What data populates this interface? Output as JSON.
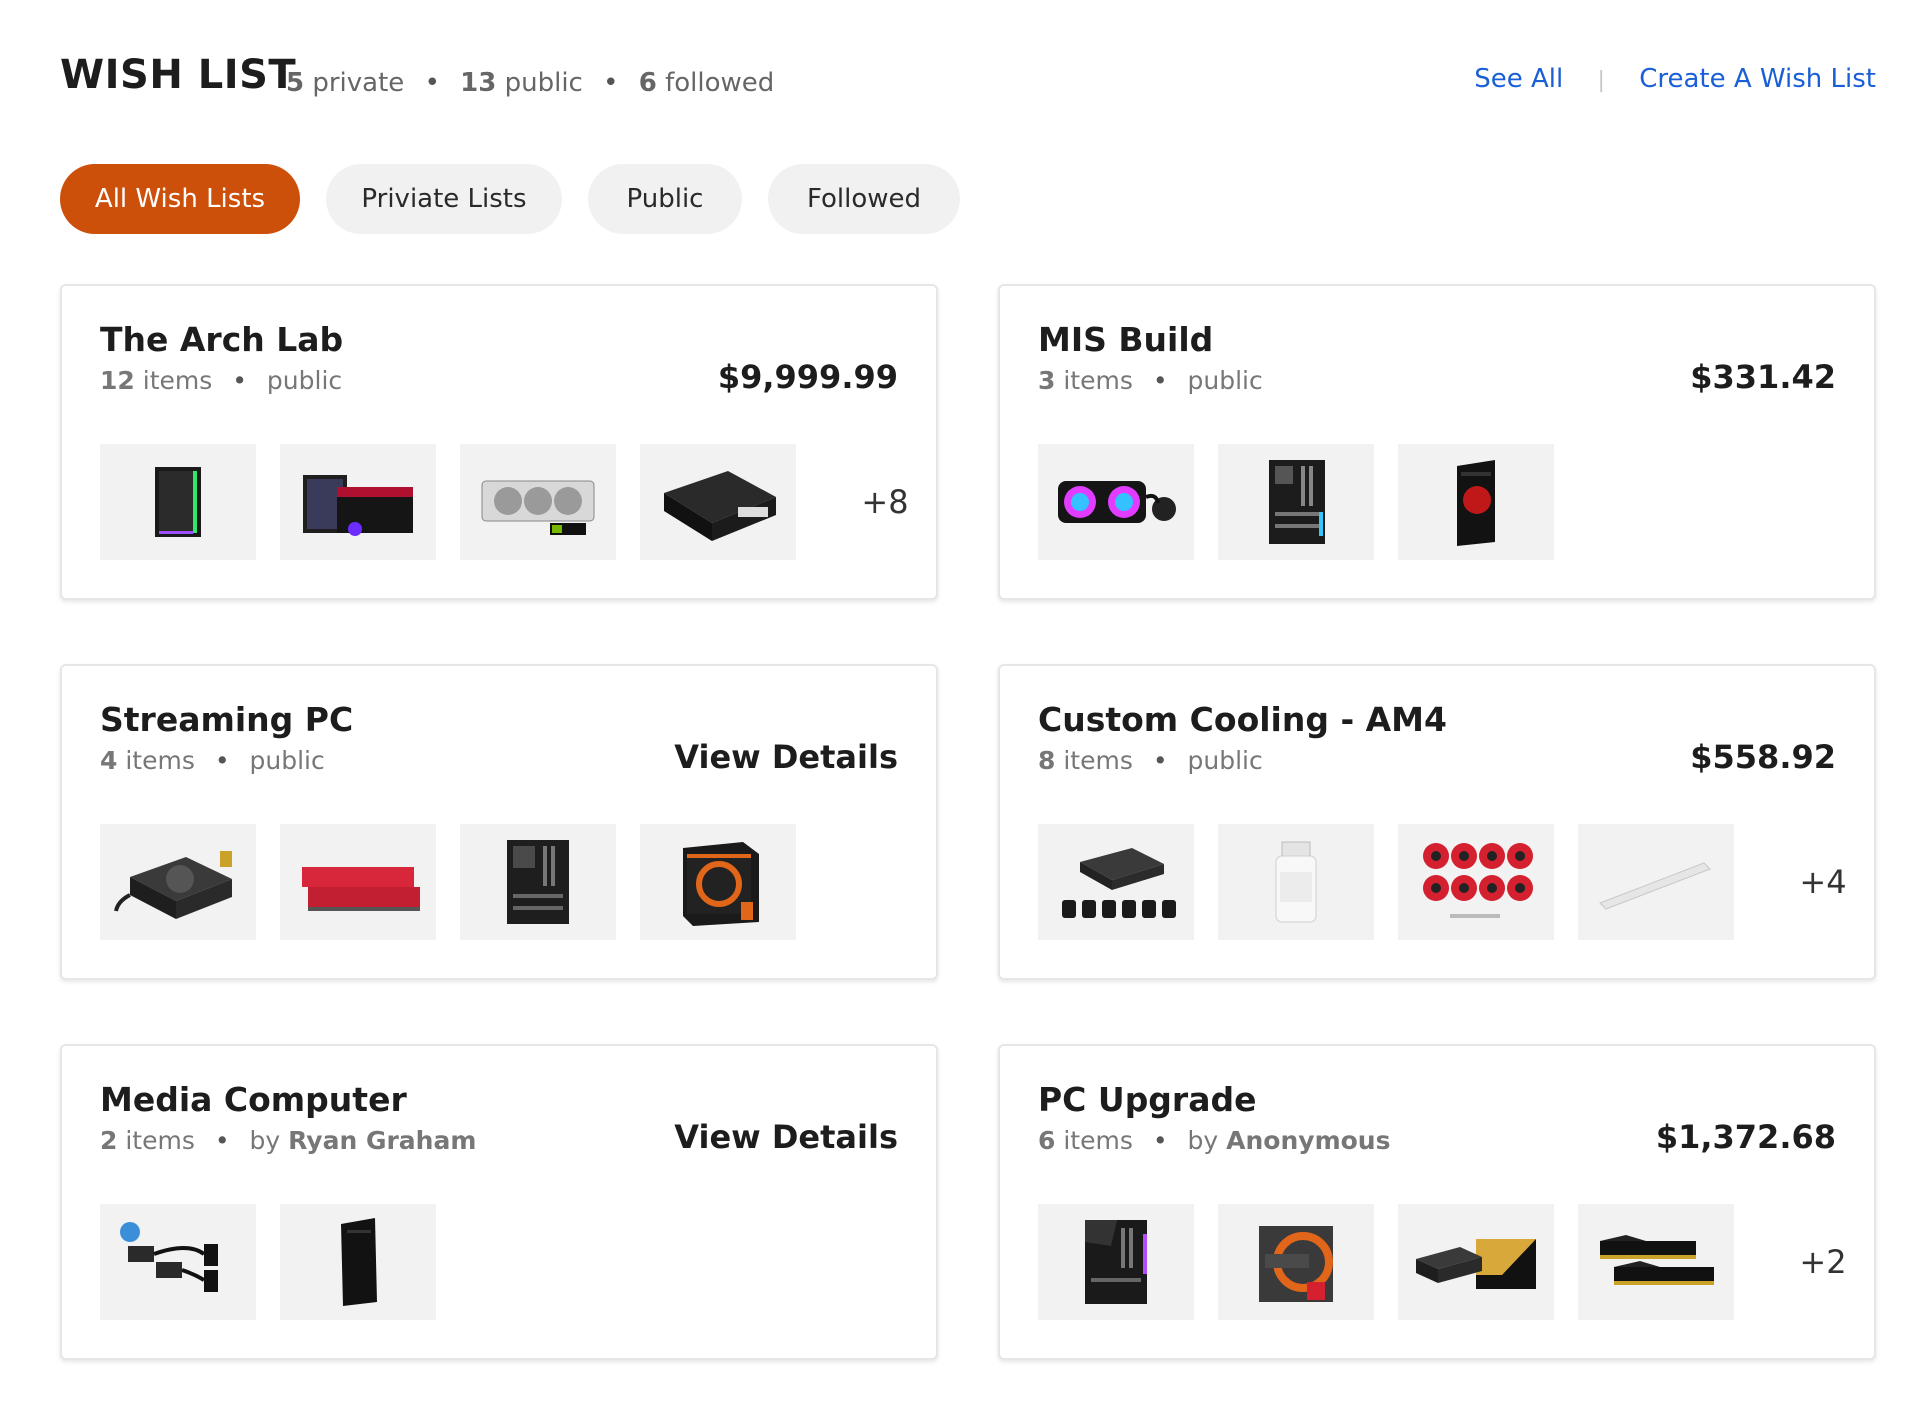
{
  "header": {
    "title": "WISH LIST",
    "stats": {
      "private_count": "5",
      "private_label": "private",
      "public_count": "13",
      "public_label": "public",
      "followed_count": "6",
      "followed_label": "followed"
    },
    "see_all": "See All",
    "separator": "|",
    "create": "Create A Wish List"
  },
  "tabs": [
    {
      "label": "All Wish Lists"
    },
    {
      "label": "Priviate Lists"
    },
    {
      "label": "Public"
    },
    {
      "label": "Followed"
    }
  ],
  "cards": [
    {
      "name": "The Arch Lab",
      "count": "12",
      "count_label": "items",
      "visibility": "public",
      "action": "$9,999.99",
      "more": "+8",
      "thumbs": [
        "pc-case-icon",
        "motherboard-box-icon",
        "graphics-card-icon",
        "power-supply-icon"
      ]
    },
    {
      "name": "MIS Build",
      "count": "3",
      "count_label": "items",
      "visibility": "public",
      "action": "$331.42",
      "more": "",
      "thumbs": [
        "liquid-cooler-icon",
        "motherboard-icon",
        "pc-case-icon"
      ]
    },
    {
      "name": "Streaming PC",
      "count": "4",
      "count_label": "items",
      "visibility": "public",
      "action": "View Details",
      "more": "",
      "thumbs": [
        "power-supply-icon",
        "ram-icon",
        "motherboard-icon",
        "cpu-box-icon"
      ]
    },
    {
      "name": "Custom Cooling - AM4",
      "count": "8",
      "count_label": "items",
      "visibility": "public",
      "action": "$558.92",
      "more": "+4",
      "thumbs": [
        "fan-hub-icon",
        "coolant-bottle-icon",
        "fittings-icon",
        "tube-icon"
      ]
    },
    {
      "name": "Media Computer",
      "count": "2",
      "count_label": "items",
      "by_label": "by",
      "author": "Ryan Graham",
      "action": "View Details",
      "more": "",
      "thumbs": [
        "adapter-cable-icon",
        "tower-pc-icon"
      ]
    },
    {
      "name": "PC Upgrade",
      "count": "6",
      "count_label": "items",
      "by_label": "by",
      "author": "Anonymous",
      "action": "$1,372.68",
      "more": "+2",
      "thumbs": [
        "motherboard-icon",
        "cpu-box-icon",
        "power-supply-icon",
        "ram-icon"
      ]
    }
  ],
  "colors": {
    "accent": "#cc4f0a",
    "link": "#1a5fd6",
    "thumb_bg": "#f2f2f2"
  }
}
